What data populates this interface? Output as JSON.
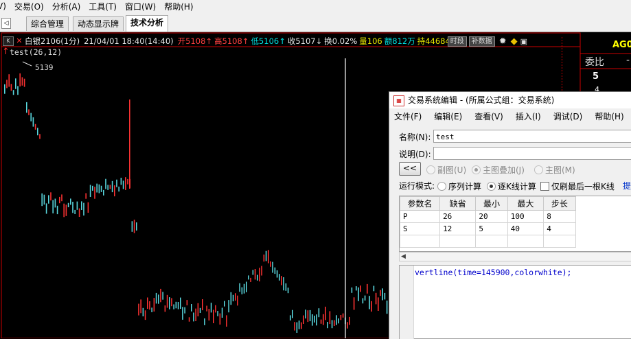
{
  "menubar": {
    "items": [
      "V)",
      "交易(O)",
      "分析(A)",
      "工具(T)",
      "窗口(W)",
      "帮助(H)"
    ]
  },
  "tabs": {
    "scroll_glyph": "◁",
    "items": [
      "综合管理",
      "动态显示牌",
      "技术分析"
    ],
    "active_index": 2
  },
  "chart": {
    "k_button": "K",
    "close_button": "✕",
    "symbol": "白银2106(1分)",
    "datetime": "21/04/01 18:40(14:40)",
    "open": "开5108↑",
    "high": "高5108↑",
    "low": "低5106↑",
    "close": "收5107↓",
    "turnover": "换0.02%",
    "volume": "量106",
    "amount": "额812万",
    "open_interest": "持44684",
    "btn_period": "时段",
    "btn_fill": "补数据",
    "formula": "test(26,12)",
    "max_label": "5139",
    "colors": {
      "up": "#ff3333",
      "down": "#5ad9e0",
      "vline": "#ffffff",
      "frame": "#cc0000"
    }
  },
  "right_panel": {
    "title": "AG0",
    "weibi": "委比",
    "weibi_value": "-",
    "row_a": "5",
    "row_b": "4"
  },
  "dialog": {
    "title": "交易系统编辑 - (所属公式组：交易系统)",
    "menu": [
      "文件(F)",
      "编辑(E)",
      "查看(V)",
      "插入(I)",
      "调试(D)",
      "帮助(H)"
    ],
    "name_label": "名称(N):",
    "name_value": "test",
    "desc_label": "说明(D):",
    "desc_value": "",
    "back_button": "<<",
    "chart_radios": [
      {
        "label": "副图(U)",
        "checked": false
      },
      {
        "label": "主图叠加(J)",
        "checked": true
      },
      {
        "label": "主图(M)",
        "checked": false
      }
    ],
    "run_mode_label": "运行模式:",
    "run_modes": [
      {
        "label": "序列计算",
        "checked": false
      },
      {
        "label": "逐K线计算",
        "checked": true
      }
    ],
    "last_bar_label": "仅刷最后一根K线",
    "cut_link": "提",
    "param_headers": [
      "参数名",
      "缺省",
      "最小",
      "最大",
      "步长"
    ],
    "params": [
      [
        "P",
        "26",
        "20",
        "100",
        "8"
      ],
      [
        "S",
        "12",
        "5",
        "40",
        "4"
      ]
    ],
    "code": "vertline(time=145900,colorwhite);"
  }
}
